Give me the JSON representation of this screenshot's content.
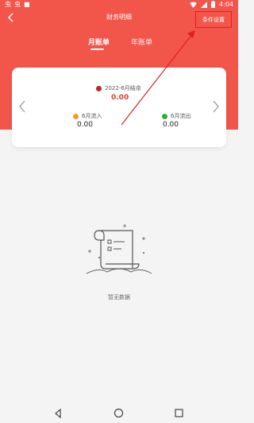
{
  "status_bar": {
    "time": "4:04"
  },
  "header": {
    "title": "财务明细",
    "settings_label": "条件设置"
  },
  "tabs": [
    {
      "label": "月账单",
      "active": true
    },
    {
      "label": "年账单",
      "active": false
    }
  ],
  "summary_card": {
    "balance_label": "2022-6月结余",
    "balance_value": "0.00",
    "income_label": "6月流入",
    "income_value": "0.00",
    "expense_label": "6月流出",
    "expense_value": "0.00"
  },
  "empty_state": {
    "text": "暂无数据"
  },
  "colors": {
    "accent": "#f2554a",
    "highlight_red": "#e02020",
    "balance_dot": "#c1272d",
    "income_dot": "#f0a020",
    "expense_dot": "#28b43c"
  }
}
